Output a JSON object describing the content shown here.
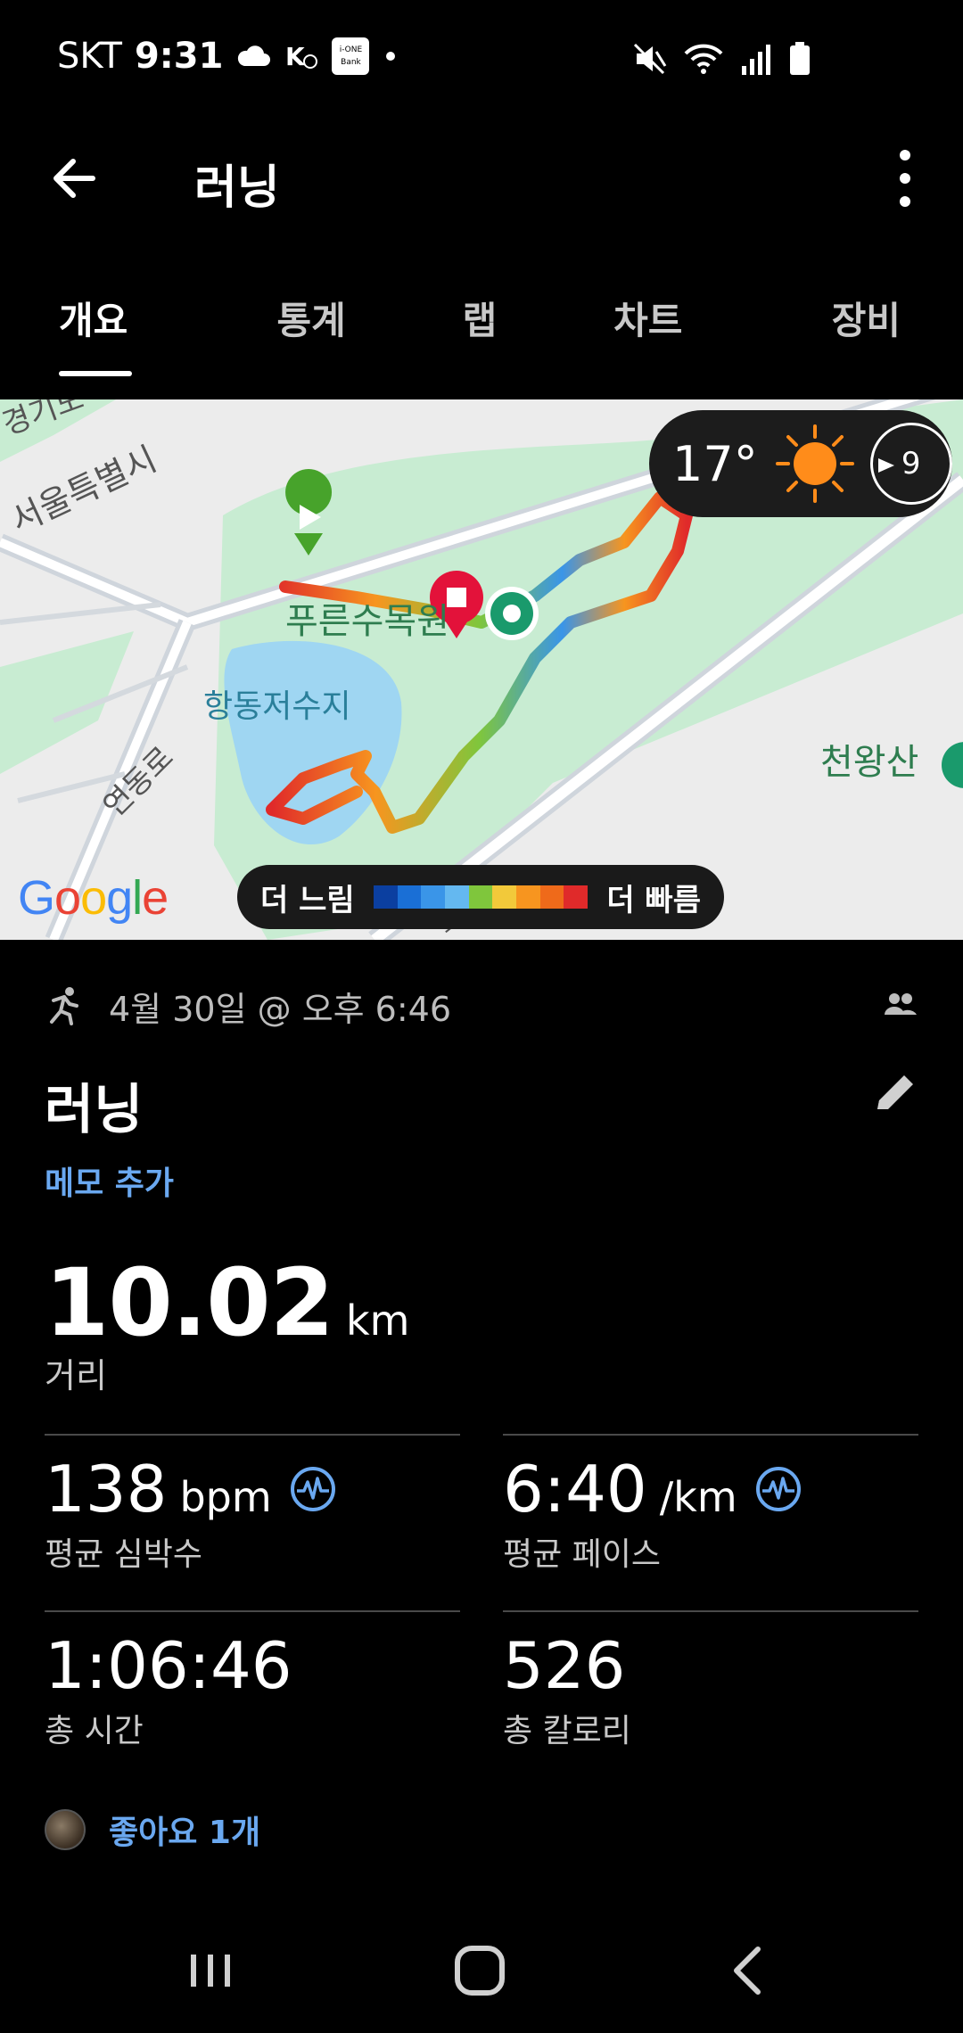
{
  "status": {
    "carrier": "SKT",
    "time": "9:31"
  },
  "app_bar": {
    "title": "러닝"
  },
  "tabs": [
    {
      "label": "개요"
    },
    {
      "label": "통계"
    },
    {
      "label": "랩"
    },
    {
      "label": "차트"
    },
    {
      "label": "장비"
    }
  ],
  "map": {
    "labels": {
      "province": "경기도",
      "city": "서울특별시",
      "park": "푸른수목원",
      "reservoir": "항동저수지",
      "road1": "연동로",
      "mountain": "천왕산",
      "road2": "오리로"
    },
    "weather": {
      "temperature": "17°",
      "wind": "9"
    },
    "legend": {
      "slow": "더 느림",
      "fast": "더 빠름"
    },
    "legend_colors": [
      "#0b3fa0",
      "#1a6fd6",
      "#3a95e8",
      "#64b8f0",
      "#7fc63c",
      "#f2c93a",
      "#f7951f",
      "#ef6a1a",
      "#e02a2a"
    ],
    "logo": "Google"
  },
  "workout": {
    "date": "4월 30일 @ 오후 6:46",
    "title": "러닝",
    "memo": "메모 추가",
    "distance": {
      "value": "10.02",
      "unit": "km",
      "label": "거리"
    },
    "heart_rate": {
      "value": "138",
      "unit": "bpm",
      "label": "평균 심박수"
    },
    "pace": {
      "value": "6:40",
      "unit": "/km",
      "label": "평균 페이스"
    },
    "duration": {
      "value": "1:06:46",
      "label": "총 시간"
    },
    "calories": {
      "value": "526",
      "label": "총 칼로리"
    },
    "likes": "좋아요 1개"
  },
  "colors": {
    "accent": "#6aa8f0",
    "background": "#000000"
  }
}
